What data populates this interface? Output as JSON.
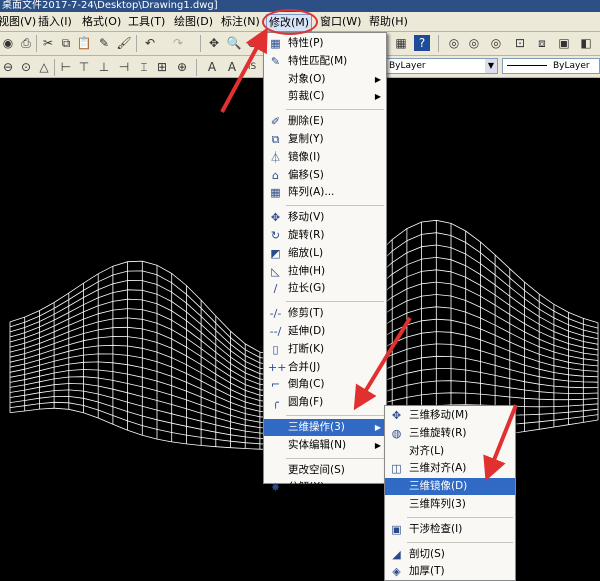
{
  "window": {
    "title": "桌面文件2017-7-24\\Desktop\\Drawing1.dwg]"
  },
  "menubar": {
    "items": [
      {
        "name": "menu-view",
        "label": "视图(V)"
      },
      {
        "name": "menu-insert",
        "label": "插入(I)"
      },
      {
        "name": "menu-format",
        "label": "格式(O)"
      },
      {
        "name": "menu-tools",
        "label": "工具(T)"
      },
      {
        "name": "menu-draw",
        "label": "绘图(D)"
      },
      {
        "name": "menu-dimension",
        "label": "标注(N)"
      },
      {
        "name": "menu-modify",
        "label": "修改(M)"
      },
      {
        "name": "menu-window",
        "label": "窗口(W)"
      },
      {
        "name": "menu-help",
        "label": "帮助(H)"
      }
    ]
  },
  "toolbar": {
    "layer_combo": "ByLayer",
    "linetype_combo": "ByLayer",
    "style_prefix": "IS"
  },
  "modify_menu": {
    "items": [
      {
        "label": "特性(P)",
        "icon": "properties-icon",
        "glyph": "▦"
      },
      {
        "label": "特性匹配(M)",
        "icon": "match-properties-icon",
        "glyph": "✎"
      },
      {
        "label": "对象(O)",
        "submenu": true
      },
      {
        "label": "剪裁(C)",
        "submenu": true
      },
      {
        "sep": true
      },
      {
        "label": "删除(E)",
        "icon": "erase-icon",
        "glyph": "✐"
      },
      {
        "label": "复制(Y)",
        "icon": "copy-icon",
        "glyph": "⧉"
      },
      {
        "label": "镜像(I)",
        "icon": "mirror-icon",
        "glyph": "⏃"
      },
      {
        "label": "偏移(S)",
        "icon": "offset-icon",
        "glyph": "⌂"
      },
      {
        "label": "阵列(A)...",
        "icon": "array-icon",
        "glyph": "▦"
      },
      {
        "sep": true
      },
      {
        "label": "移动(V)",
        "icon": "move-icon",
        "glyph": "✥"
      },
      {
        "label": "旋转(R)",
        "icon": "rotate-icon",
        "glyph": "↻"
      },
      {
        "label": "缩放(L)",
        "icon": "scale-icon",
        "glyph": "◩"
      },
      {
        "label": "拉伸(H)",
        "icon": "stretch-icon",
        "glyph": "◺"
      },
      {
        "label": "拉长(G)",
        "icon": "lengthen-icon",
        "glyph": "∕"
      },
      {
        "sep": true
      },
      {
        "label": "修剪(T)",
        "icon": "trim-icon",
        "glyph": "-/-"
      },
      {
        "label": "延伸(D)",
        "icon": "extend-icon",
        "glyph": "--/"
      },
      {
        "label": "打断(K)",
        "icon": "break-icon",
        "glyph": "▯"
      },
      {
        "label": "合并(J)",
        "icon": "join-icon",
        "glyph": "++"
      },
      {
        "label": "倒角(C)",
        "icon": "chamfer-icon",
        "glyph": "⌐"
      },
      {
        "label": "圆角(F)",
        "icon": "fillet-icon",
        "glyph": "╭"
      },
      {
        "sep": true
      },
      {
        "label": "三维操作(3)",
        "submenu": true,
        "highlighted": true
      },
      {
        "label": "实体编辑(N)",
        "submenu": true
      },
      {
        "sep": true
      },
      {
        "label": "更改空间(S)"
      },
      {
        "label": "分解(X)",
        "icon": "explode-icon",
        "glyph": "✸"
      }
    ]
  },
  "three_d_menu": {
    "items": [
      {
        "label": "三维移动(M)",
        "icon": "3d-move-icon",
        "glyph": "✥"
      },
      {
        "label": "三维旋转(R)",
        "icon": "3d-rotate-icon",
        "glyph": "◍"
      },
      {
        "label": "对齐(L)"
      },
      {
        "label": "三维对齐(A)",
        "icon": "3d-align-icon",
        "glyph": "◫"
      },
      {
        "label": "三维镜像(D)",
        "highlighted": true
      },
      {
        "label": "三维阵列(3)"
      },
      {
        "sep": true
      },
      {
        "label": "干涉检查(I)",
        "icon": "interference-icon",
        "glyph": "▣"
      },
      {
        "sep": true
      },
      {
        "label": "剖切(S)",
        "icon": "slice-icon",
        "glyph": "◢"
      },
      {
        "label": "加厚(T)",
        "icon": "thicken-icon",
        "glyph": "◈"
      }
    ]
  },
  "colors": {
    "highlight": "#316ac5",
    "annotation": "#e03030",
    "mesh": "#ffffff",
    "canvas": "#000000"
  }
}
